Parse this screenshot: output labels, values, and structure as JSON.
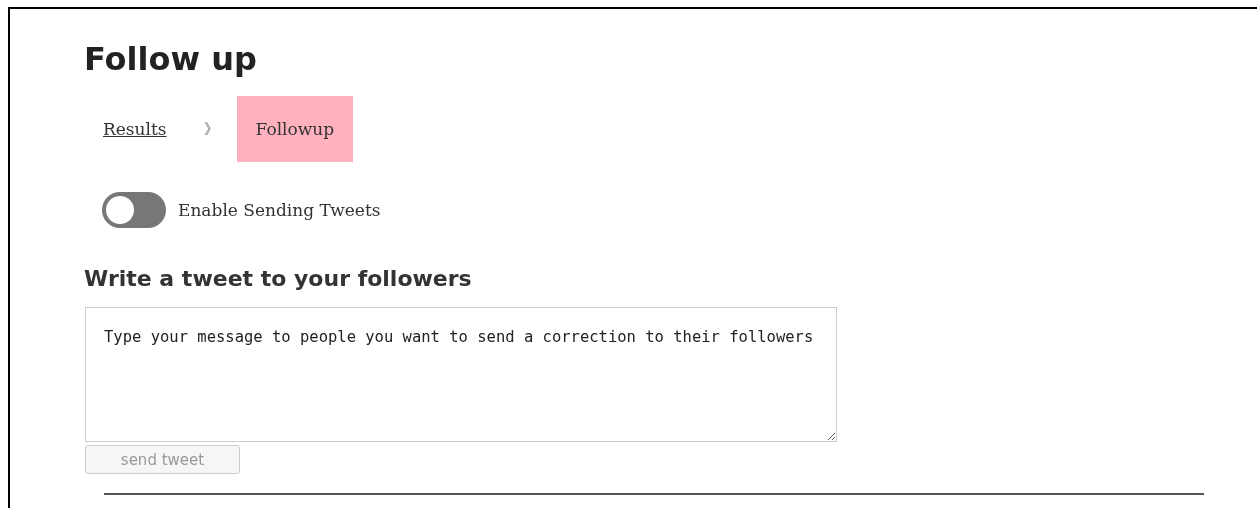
{
  "title": "Follow up",
  "breadcrumb": [
    {
      "label": "Results",
      "selected": false
    },
    {
      "label": "Followup",
      "selected": true
    }
  ],
  "breadcrumb_separator": "》",
  "toggle": {
    "label": "Enable Sending Tweets",
    "on": false
  },
  "compose": {
    "heading": "Write a tweet to your followers",
    "placeholder": "Type your message to people you want to send a correction to their followers",
    "button": {
      "label": "send tweet",
      "disabled": true
    }
  }
}
